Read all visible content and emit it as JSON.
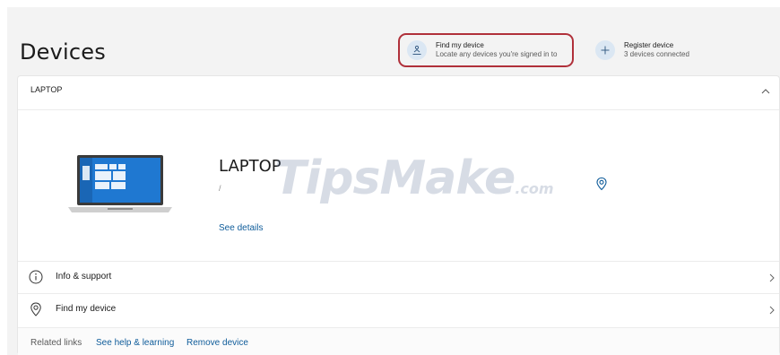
{
  "page": {
    "title": "Devices"
  },
  "actions": {
    "find": {
      "title": "Find my device",
      "subtitle": "Locate any devices you're signed in to",
      "icon": "person-location-icon"
    },
    "register": {
      "title": "Register device",
      "subtitle": "3 devices connected",
      "icon": "plus-icon"
    }
  },
  "card": {
    "header_name": "LAPTOP",
    "device_name": "LAPTOP",
    "device_sub": "/",
    "see_details": "See details",
    "rows": [
      {
        "label": "Info & support",
        "icon": "info-icon"
      },
      {
        "label": "Find my device",
        "icon": "location-pin-icon"
      }
    ],
    "related": {
      "label": "Related links",
      "help": "See help & learning",
      "remove": "Remove device"
    }
  },
  "watermark": {
    "main": "TipsMake",
    "suffix": ".com"
  },
  "colors": {
    "accent": "#0f5c9a",
    "highlight_border": "#b0303a",
    "icon_circle": "#dbe7f3"
  }
}
